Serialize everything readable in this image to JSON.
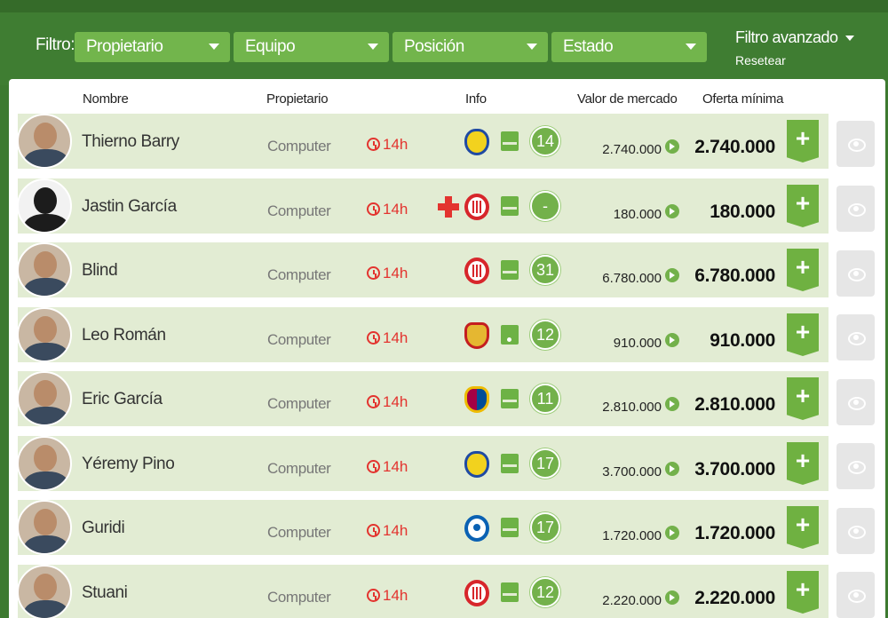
{
  "filter": {
    "label": "Filtro:",
    "dropdowns": [
      "Propietario",
      "Equipo",
      "Posición",
      "Estado"
    ],
    "advanced": "Filtro avanzado",
    "reset": "Resetear"
  },
  "table": {
    "headers": {
      "name": "Nombre",
      "owner": "Propietario",
      "info": "Info",
      "market": "Valor de mercado",
      "offer": "Oferta mínima"
    },
    "rows": [
      {
        "name": "Thierno Barry",
        "owner": "Computer",
        "time": "14h",
        "team": "villarreal-crest-icon",
        "score": "14",
        "market": "2.740.000",
        "offer": "2.740.000",
        "injured": false,
        "avatar": "photo"
      },
      {
        "name": "Jastin García",
        "owner": "Computer",
        "time": "14h",
        "team": "girona-crest-icon",
        "score": "-",
        "market": "180.000",
        "offer": "180.000",
        "injured": true,
        "avatar": "silhouette"
      },
      {
        "name": "Blind",
        "owner": "Computer",
        "time": "14h",
        "team": "girona-crest-icon",
        "score": "31",
        "market": "6.780.000",
        "offer": "6.780.000",
        "injured": false,
        "avatar": "photo"
      },
      {
        "name": "Leo Román",
        "owner": "Computer",
        "time": "14h",
        "team": "mallorca-crest-icon",
        "score": "12",
        "market": "910.000",
        "offer": "910.000",
        "injured": false,
        "avatar": "photo"
      },
      {
        "name": "Eric García",
        "owner": "Computer",
        "time": "14h",
        "team": "barcelona-crest-icon",
        "score": "11",
        "market": "2.810.000",
        "offer": "2.810.000",
        "injured": false,
        "avatar": "photo"
      },
      {
        "name": "Yéremy Pino",
        "owner": "Computer",
        "time": "14h",
        "team": "villarreal-crest-icon",
        "score": "17",
        "market": "3.700.000",
        "offer": "3.700.000",
        "injured": false,
        "avatar": "photo"
      },
      {
        "name": "Guridi",
        "owner": "Computer",
        "time": "14h",
        "team": "alaves-crest-icon",
        "score": "17",
        "market": "1.720.000",
        "offer": "1.720.000",
        "injured": false,
        "avatar": "photo"
      },
      {
        "name": "Stuani",
        "owner": "Computer",
        "time": "14h",
        "team": "girona-crest-icon",
        "score": "12",
        "market": "2.220.000",
        "offer": "2.220.000",
        "injured": false,
        "avatar": "photo"
      }
    ]
  },
  "colors": {
    "header_bg": "#3f7d32",
    "dropdown_bg": "#72b54c",
    "row_bg": "#e2ecd3",
    "accent": "#6fb141",
    "alert": "#e3342f"
  }
}
